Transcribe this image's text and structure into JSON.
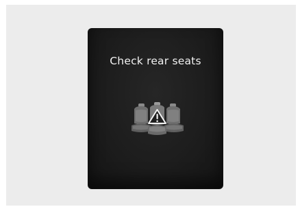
{
  "cluster": {
    "message": "Check rear seats",
    "icon": "rear-seats-warning-icon"
  },
  "colors": {
    "background": "#ececec",
    "screen": "#1f1f1f",
    "text": "#f2f2f2",
    "icon_seat": "#6f6f6f",
    "icon_seat_light": "#9a9a9a",
    "icon_warning": "#f2f2f2"
  }
}
